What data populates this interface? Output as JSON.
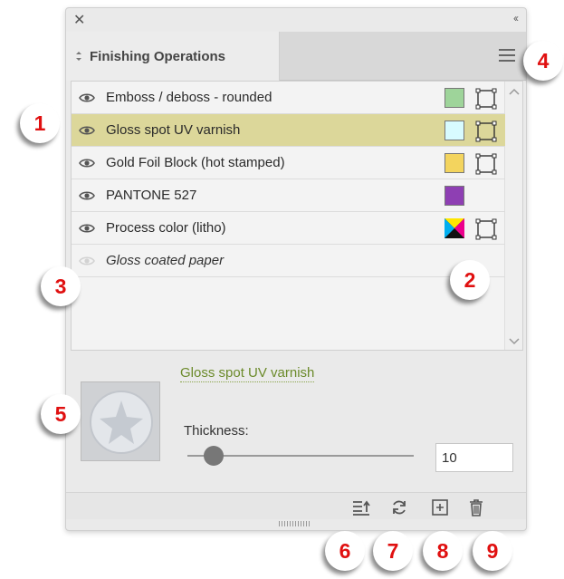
{
  "panel": {
    "title": "Finishing Operations",
    "close_glyph": "✕",
    "collapse_glyph": "‹‹",
    "updown_glyph": "⇕"
  },
  "operations": [
    {
      "name": "Emboss / deboss - rounded",
      "visible": true,
      "swatch": "#9ed49a",
      "frame": true,
      "selected": false,
      "italic": false
    },
    {
      "name": "Gloss spot UV varnish",
      "visible": true,
      "swatch": "#d8fbff",
      "frame": true,
      "selected": true,
      "italic": false
    },
    {
      "name": "Gold Foil Block (hot stamped)",
      "visible": true,
      "swatch": "#f3d45e",
      "frame": true,
      "selected": false,
      "italic": false
    },
    {
      "name": "PANTONE 527",
      "visible": true,
      "swatch": "#8e3fb3",
      "frame": false,
      "selected": false,
      "italic": false
    },
    {
      "name": "Process color (litho)",
      "visible": true,
      "swatch": "process",
      "frame": true,
      "selected": false,
      "italic": false
    },
    {
      "name": "Gloss coated paper",
      "visible": false,
      "swatch": null,
      "frame": false,
      "selected": false,
      "italic": true
    }
  ],
  "detail": {
    "selected_name": "Gloss spot UV varnish",
    "thickness_label": "Thickness:",
    "thickness_value": "10",
    "thickness_slider_fraction": 0.1
  },
  "toolbar": {
    "buttons": [
      "sort-icon",
      "refresh-icon",
      "add-icon",
      "trash-icon"
    ]
  },
  "callouts": [
    "1",
    "2",
    "3",
    "4",
    "5",
    "6",
    "7",
    "8",
    "9"
  ],
  "colors": {
    "selected_row": "#dcd79a",
    "detail_name": "#6b8a2a",
    "callout_text": "#e01010"
  }
}
